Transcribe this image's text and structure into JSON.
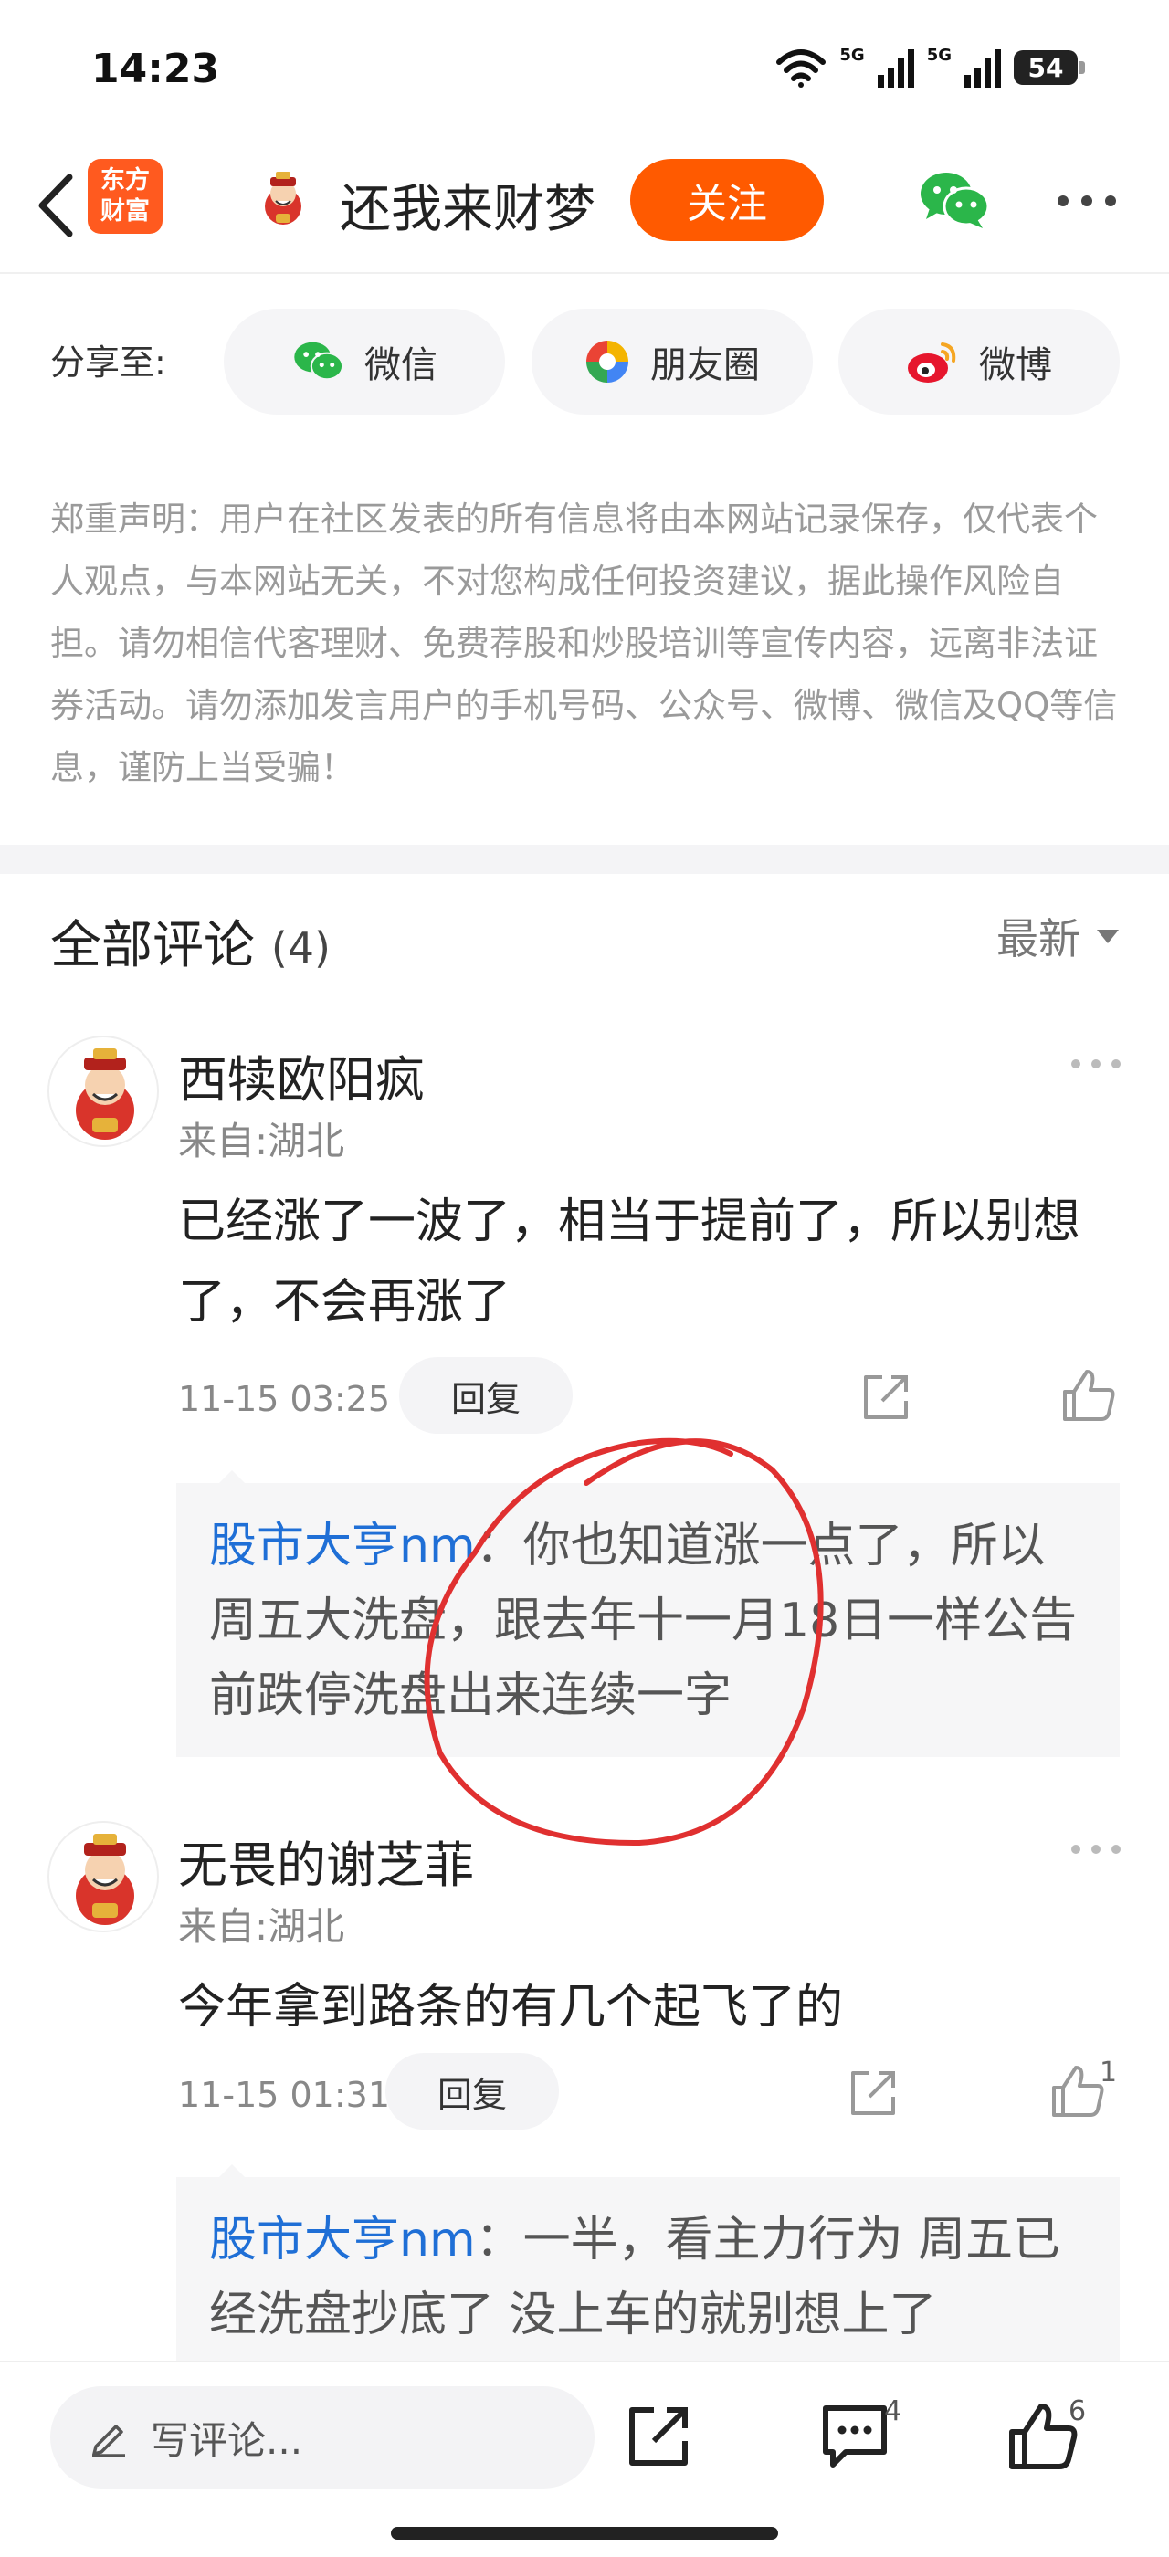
{
  "status_bar": {
    "time": "14:23",
    "signal_1": "5G",
    "signal_2": "5G",
    "battery": "54"
  },
  "nav": {
    "app_logo_line1": "东方",
    "app_logo_line2": "财富",
    "title": "还我来财梦",
    "follow_label": "关注"
  },
  "share": {
    "label": "分享至:",
    "wechat": "微信",
    "moments": "朋友圈",
    "weibo": "微博"
  },
  "disclaimer": "郑重声明：用户在社区发表的所有信息将由本网站记录保存，仅代表个人观点，与本网站无关，不对您构成任何投资建议，据此操作风险自担。请勿相信代客理财、免费荐股和炒股培训等宣传内容，远离非法证券活动。请勿添加发言用户的手机号码、公众号、微博、微信及QQ等信息，谨防上当受骗！",
  "comments_header": {
    "title": "全部评论",
    "count": "(4)",
    "sort": "最新"
  },
  "comments": [
    {
      "name": "西犊欧阳疯",
      "from": "来自:湖北",
      "text": "已经涨了一波了，相当于提前了，所以别想了，不会再涨了",
      "time": "11-15 03:25",
      "reply_label": "回复",
      "likes": "",
      "reply": {
        "who": "股市大亨nm",
        "sep": "：",
        "text": "你也知道涨一点了，所以周五大洗盘，跟去年十一月18日一样公告前跌停洗盘出来连续一字"
      }
    },
    {
      "name": "无畏的谢芝菲",
      "from": "来自:湖北",
      "text": "今年拿到路条的有几个起飞了的",
      "time": "11-15 01:31",
      "reply_label": "回复",
      "likes": "1",
      "reply": {
        "who": "股市大亨nm",
        "sep": "：",
        "text": "一半，看主力行为 周五已经洗盘抄底了 没上车的就别想上了"
      }
    }
  ],
  "bottom_bar": {
    "placeholder": "写评论...",
    "comment_count": "4",
    "like_count": "6"
  },
  "colors": {
    "accent": "#ff5a00",
    "link": "#1f6fd6",
    "annotation": "#e03030"
  }
}
